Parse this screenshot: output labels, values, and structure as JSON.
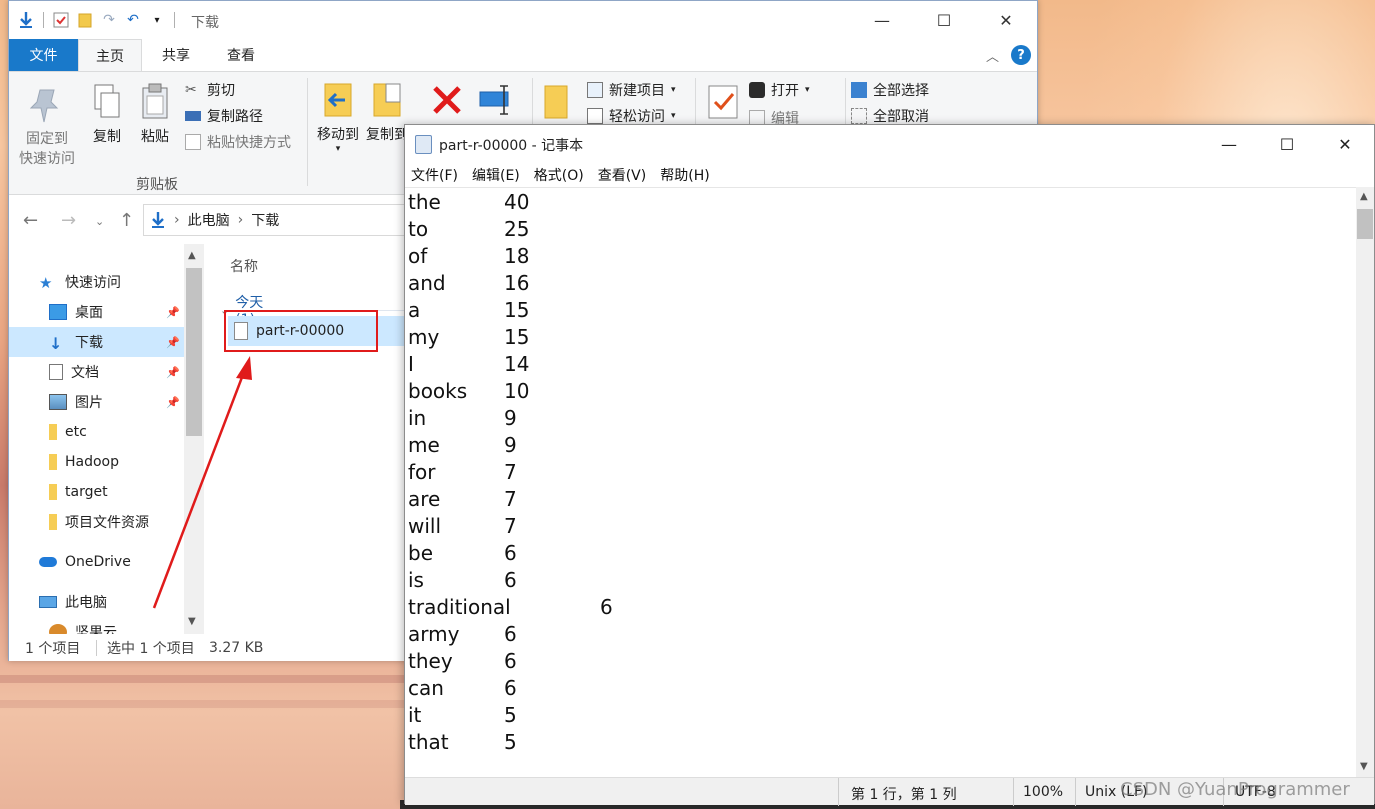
{
  "colors": {
    "ribbon_file_tab": "#1979ca",
    "selection": "#cce8ff",
    "annotation": "#e01b1b"
  },
  "explorer": {
    "title": "下载",
    "tabs": {
      "file": "文件",
      "home": "主页",
      "share": "共享",
      "view": "查看"
    },
    "ribbon": {
      "pin": "固定到\n快速访问",
      "pin_line1": "固定到",
      "pin_line2": "快速访问",
      "copy": "复制",
      "paste": "粘贴",
      "cut": "剪切",
      "copy_path": "复制路径",
      "paste_shortcut": "粘贴快捷方式",
      "clipboard_group": "剪贴板",
      "move_to": "移动到",
      "copy_to": "复制到",
      "new_item": "新建项目",
      "easy_access": "轻松访问",
      "open": "打开",
      "edit": "编辑",
      "select_all": "全部选择",
      "select_none": "全部取消"
    },
    "address": {
      "root": "此电脑",
      "current": "下载"
    },
    "nav": {
      "quick_access": "快速访问",
      "items": [
        "桌面",
        "下载",
        "文档",
        "图片",
        "etc",
        "Hadoop",
        "target",
        "项目文件资源"
      ],
      "onedrive": "OneDrive",
      "this_pc": "此电脑",
      "partial": "坚果云"
    },
    "content": {
      "column_name": "名称",
      "group": "今天 (1)",
      "file": "part-r-00000"
    },
    "status": {
      "count": "1 个项目",
      "selected": "选中 1 个项目",
      "size": "3.27 KB"
    }
  },
  "notepad": {
    "title": "part-r-00000 - 记事本",
    "menu": [
      "文件(F)",
      "编辑(E)",
      "格式(O)",
      "查看(V)",
      "帮助(H)"
    ],
    "lines": [
      {
        "word": "the",
        "count": "40"
      },
      {
        "word": "to",
        "count": "25"
      },
      {
        "word": "of",
        "count": "18"
      },
      {
        "word": "and",
        "count": "16"
      },
      {
        "word": "a",
        "count": "15"
      },
      {
        "word": "my",
        "count": "15"
      },
      {
        "word": "I",
        "count": "14"
      },
      {
        "word": "books",
        "count": "10"
      },
      {
        "word": "in",
        "count": "9"
      },
      {
        "word": "me",
        "count": "9"
      },
      {
        "word": "for",
        "count": "7"
      },
      {
        "word": "are",
        "count": "7"
      },
      {
        "word": "will",
        "count": "7"
      },
      {
        "word": "be",
        "count": "6"
      },
      {
        "word": "is",
        "count": "6"
      },
      {
        "word": "traditional",
        "count": "6"
      },
      {
        "word": "army",
        "count": "6"
      },
      {
        "word": "they",
        "count": "6"
      },
      {
        "word": "can",
        "count": "6"
      },
      {
        "word": "it",
        "count": "5"
      },
      {
        "word": "that",
        "count": "5"
      }
    ],
    "status": {
      "position": "第 1 行，第 1 列",
      "zoom": "100%",
      "eol": "Unix (LF)",
      "encoding": "UTF-8"
    }
  },
  "watermark": "CSDN @YuanProgrammer"
}
